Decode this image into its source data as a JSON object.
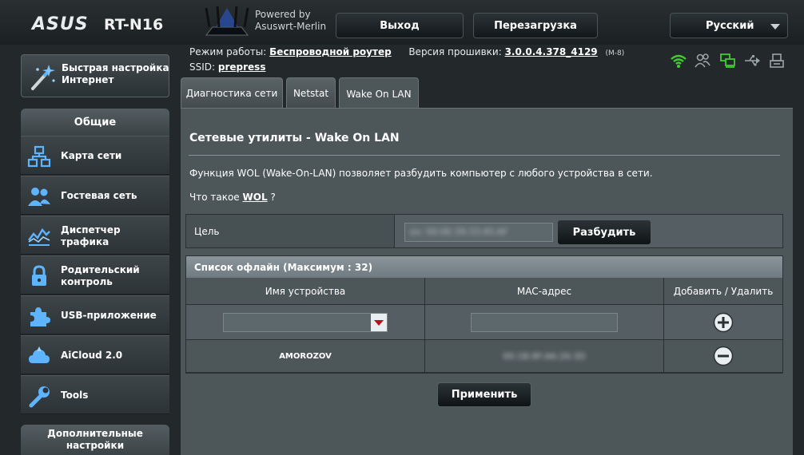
{
  "header": {
    "brand": "ASUS",
    "model": "RT-N16",
    "powered_by_line1": "Powered by",
    "powered_by_line2": "Asuswrt-Merlin",
    "logout_label": "Выход",
    "reboot_label": "Перезагрузка",
    "language_label": "Русский"
  },
  "info": {
    "mode_label": "Режим работы:",
    "mode_value": "Беспроводной роутер",
    "firmware_label": "Версия прошивки:",
    "firmware_value": "3.0.0.4.378_4129",
    "firmware_suffix": "(M-8)",
    "ssid_label": "SSID:",
    "ssid_value": "prepress"
  },
  "status_icons": [
    "wifi-icon",
    "clients-icon",
    "network-icon",
    "usb-icon",
    "printer-icon"
  ],
  "colors": {
    "status_green": "#3ecf2f",
    "status_grey": "#9aa4a7",
    "select_arrow": "#b1141a"
  },
  "sidebar": {
    "quick_setup": "Быстрая настройка Интернет",
    "general_heading": "Общие",
    "items": [
      {
        "label": "Карта сети",
        "icon": "network-map-icon"
      },
      {
        "label": "Гостевая сеть",
        "icon": "guest-network-icon"
      },
      {
        "label": "Диспетчер трафика",
        "icon": "traffic-manager-icon"
      },
      {
        "label": "Родительский контроль",
        "icon": "lock-icon"
      },
      {
        "label": "USB-приложение",
        "icon": "puzzle-icon"
      },
      {
        "label": "AiCloud 2.0",
        "icon": "cloud-icon"
      },
      {
        "label": "Tools",
        "icon": "wrench-icon"
      }
    ],
    "advanced_heading": "Дополнительные настройки"
  },
  "tabs": [
    {
      "label": "Диагностика сети"
    },
    {
      "label": "Netstat"
    },
    {
      "label": "Wake On LAN"
    }
  ],
  "main": {
    "title": "Сетевые утилиты - Wake On LAN",
    "description": "Функция WOL (Wake-On-LAN) позволяет разбудить компьютер с любого устройства в сети.",
    "whatis_prefix": "Что такое",
    "whatis_link": "WOL",
    "whatis_suffix": "?",
    "target_label": "Цель",
    "target_placeholder": "ex: 00:0E:39:33:45:AF",
    "wake_button": "Разбудить",
    "offline_list_title": "Список офлайн (Максимум : 32)",
    "columns": [
      "Имя устройства",
      "MAC-адрес",
      "Добавить / Удалить"
    ],
    "devices": [
      {
        "name": "AMOROZOV",
        "mac": "00:1B:9F:A6:26:3D"
      }
    ],
    "apply_button": "Применить"
  }
}
